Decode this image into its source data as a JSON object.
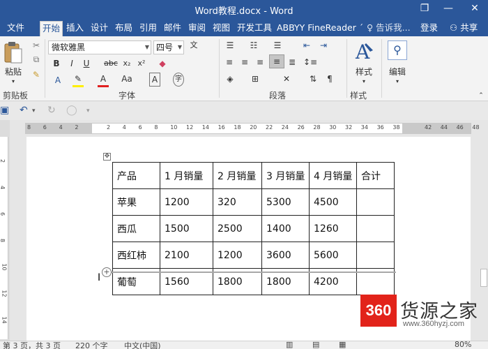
{
  "window": {
    "title": "Word教程.docx - Word",
    "minimize": "—",
    "restore": "❐",
    "close": "✕",
    "help": "?"
  },
  "tabs": [
    "文件",
    "开始",
    "插入",
    "设计",
    "布局",
    "引用",
    "邮件",
    "审阅",
    "视图",
    "开发工具",
    "ABBYY FineReader ´"
  ],
  "tell_me": "告诉我...",
  "login": "登录",
  "share": "共享",
  "ribbon": {
    "paste": "粘贴",
    "clipboard": "剪贴板",
    "font_name": "微软雅黑",
    "font_size": "四号",
    "font_group": "字体",
    "paragraph_group": "段落",
    "styles": "样式",
    "styles_group": "样式",
    "edit": "编辑",
    "bold": "B",
    "italic": "I",
    "underline": "U",
    "strike": "abc",
    "subscript": "x₂",
    "superscript": "x²",
    "fontcolor": "A",
    "fontsize_btn": "Aa",
    "wen": "文",
    "char_a": "A"
  },
  "ruler_ticks": [
    "8",
    "6",
    "4",
    "2",
    "",
    "2",
    "4",
    "6",
    "8",
    "10",
    "12",
    "14",
    "16",
    "18",
    "20",
    "22",
    "24",
    "26",
    "28",
    "30",
    "32",
    "34",
    "36",
    "38",
    "",
    "42",
    "44",
    "46",
    "48"
  ],
  "vruler_ticks": [
    "2",
    "4",
    "6",
    "8",
    "10",
    "12",
    "14"
  ],
  "table": {
    "rows": [
      [
        "产品",
        "1 月销量",
        "2 月销量",
        "3 月销量",
        "4 月销量",
        "合计"
      ],
      [
        "苹果",
        "1200",
        "320",
        "5300",
        "4500",
        ""
      ],
      [
        "西瓜",
        "1500",
        "2500",
        "1400",
        "1260",
        ""
      ],
      [
        "西红柿",
        "2100",
        "1200",
        "3600",
        "5600",
        ""
      ],
      [
        "葡萄",
        "1560",
        "1800",
        "1800",
        "4200",
        ""
      ]
    ]
  },
  "status": {
    "pages": "第 3 页，共 3 页",
    "words": "220 个字",
    "lang": "中文(中国)",
    "zoom": "80%"
  },
  "watermark": {
    "logo": "360",
    "name": "货源之家",
    "url": "www.360hyzj.com"
  }
}
